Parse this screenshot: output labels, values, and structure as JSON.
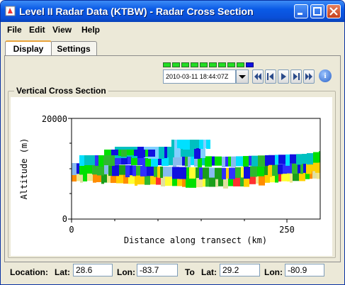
{
  "window": {
    "title": "Level II Radar Data (KTBW) - Radar Cross Section"
  },
  "menu": {
    "file": "File",
    "edit": "Edit",
    "view": "View",
    "help": "Help"
  },
  "tabs": {
    "display": "Display",
    "settings": "Settings"
  },
  "time": {
    "value": "2010-03-11 18:44:07Z"
  },
  "info_label": "i",
  "legend": "Vertical Cross Section",
  "chart_data": {
    "type": "heatmap",
    "title": "",
    "xlabel": "Distance along transect (km)",
    "ylabel": "Altitude (m)",
    "xticks": [
      "0",
      "250"
    ],
    "yticks": [
      "20000",
      "0"
    ],
    "xlim": [
      0,
      350
    ],
    "ylim": [
      0,
      20000
    ]
  },
  "location": {
    "label": "Location:",
    "lat_label": "Lat:",
    "lat": "28.6",
    "lon_label": "Lon:",
    "lon": "-83.7",
    "to_label": "To",
    "lat2_label": "Lat:",
    "lat2": "29.2",
    "lon2_label": "Lon:",
    "lon2": "-80.9"
  },
  "colors": {
    "titlebar": "#0a5ae6",
    "led_green": "#22dd22",
    "led_blue": "#1010e0"
  }
}
